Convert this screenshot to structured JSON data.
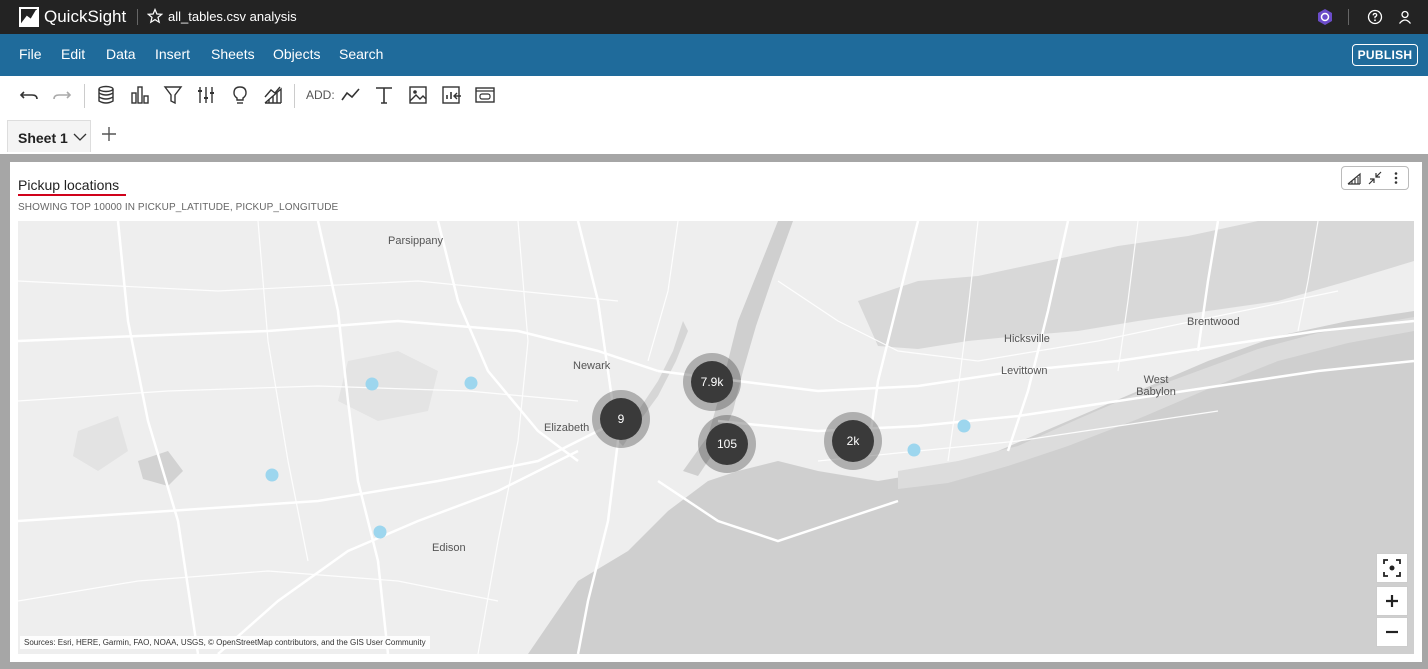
{
  "app": {
    "name": "QuickSight",
    "analysis_title": "all_tables.csv analysis"
  },
  "menu": {
    "items": [
      "File",
      "Edit",
      "Data",
      "Insert",
      "Sheets",
      "Objects",
      "Search"
    ],
    "publish_label": "PUBLISH"
  },
  "toolbar": {
    "add_label": "ADD:",
    "icons": [
      "undo-icon",
      "redo-icon",
      "dataset-icon",
      "visualize-icon",
      "filter-icon",
      "parameters-icon",
      "insights-icon",
      "ml-insights-icon",
      "add-chart-icon",
      "add-text-icon",
      "add-image-icon",
      "add-insight-icon",
      "add-embed-icon"
    ]
  },
  "sheets": {
    "tabs": [
      {
        "label": "Sheet 1"
      }
    ],
    "add_icon": "plus-icon"
  },
  "visual": {
    "title": "Pickup locations",
    "subtitle": "SHOWING TOP 10000 IN PICKUP_LATITUDE, PICKUP_LONGITUDE",
    "menu_icons": [
      "format-visual-icon",
      "collapse-icon",
      "more-options-icon"
    ],
    "map": {
      "places": [
        "Parsippany",
        "Newark",
        "Elizabeth",
        "Edison",
        "Hicksville",
        "Levittown",
        "West Babylon",
        "Brentwood"
      ],
      "clusters": [
        {
          "label": "7.9k"
        },
        {
          "label": "9"
        },
        {
          "label": "105"
        },
        {
          "label": "2k"
        }
      ],
      "attribution": "Sources: Esri, HERE, Garmin, FAO, NOAA, USGS, © OpenStreetMap contributors, and the GIS User Community",
      "controls": [
        "recenter-icon",
        "zoom-in-icon",
        "zoom-out-icon"
      ]
    }
  },
  "colors": {
    "topbar": "#232323",
    "menubar": "#1f6b9b",
    "cluster": "#3a3a3a",
    "point": "#9dd6ee",
    "accent": "#d0021b",
    "water": "#cfcfcf"
  }
}
